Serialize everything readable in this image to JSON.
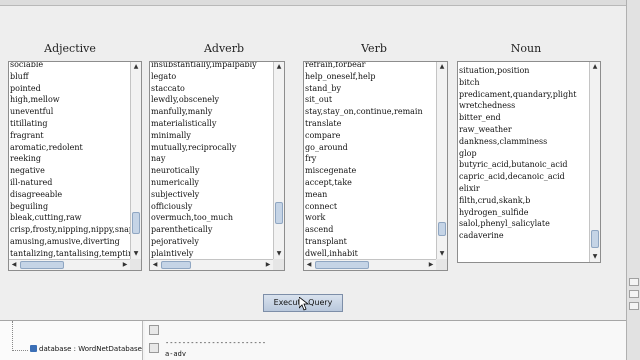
{
  "columns": [
    {
      "title": "Adjective",
      "items": [
        "sociable",
        "bluff",
        "pointed",
        "high,mellow",
        "uneventful",
        "titillating",
        "fragrant",
        "aromatic,redolent",
        "reeking",
        "negative",
        "ill-natured",
        "disagreeable",
        "beguiling",
        "bleak,cutting,raw",
        "crisp,frosty,nipping,nippy,snappy",
        "amusing,amusive,diverting",
        "tantalizing,tantalising,tempting"
      ]
    },
    {
      "title": "Adverb",
      "items": [
        "insubstantially,impalpably",
        "legato",
        "staccato",
        "lewdly,obscenely",
        "manfully,manly",
        "materialistically",
        "minimally",
        "mutually,reciprocally",
        "nay",
        "neurotically",
        "numerically",
        "subjectively",
        "officiously",
        "overmuch,too_much",
        "parenthetically",
        "pejoratively",
        "plaintively"
      ]
    },
    {
      "title": "Verb",
      "items": [
        "refrain,forbear",
        "help_oneself,help",
        "stand_by",
        "sit_out",
        "stay,stay_on,continue,remain",
        "translate",
        "compare",
        "go_around",
        "fry",
        "miscegenate",
        "accept,take",
        "mean",
        "connect",
        "work",
        "ascend",
        "transplant",
        "dwell,inhabit"
      ]
    },
    {
      "title": "Noun",
      "items": [
        "situation,position",
        "bitch",
        "predicament,quandary,plight",
        "wretchedness",
        "bitter_end",
        "raw_weather",
        "dankness,clamminess",
        "glop",
        "butyric_acid,butanoic_acid",
        "capric_acid,decanoic_acid",
        "elixir",
        "filth,crud,skank,b",
        "hydrogen_sulfide",
        "salol,phenyl_salicylate",
        "cadaverine"
      ]
    }
  ],
  "execute_button": {
    "label": "Execute Query"
  },
  "tree": {
    "database_label": "database : WordNetDatabase"
  },
  "output": {
    "separator": "------------------------",
    "line": "a-adv"
  },
  "colors": {
    "accent": "#b9c8dc",
    "border": "#8d8d8d"
  }
}
